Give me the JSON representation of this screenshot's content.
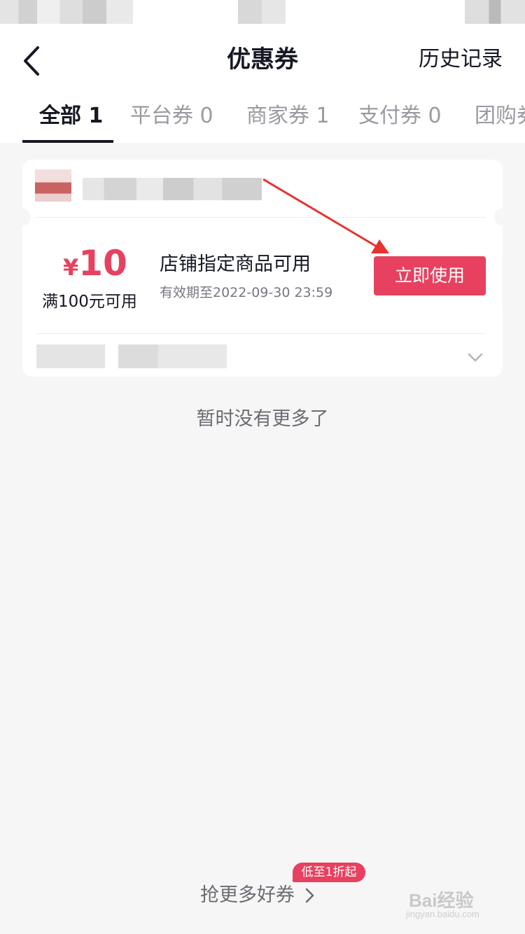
{
  "header": {
    "title": "优惠券",
    "history_label": "历史记录"
  },
  "tabs": [
    {
      "label": "全部 1",
      "active": true
    },
    {
      "label": "平台券 0",
      "active": false
    },
    {
      "label": "商家券 1",
      "active": false
    },
    {
      "label": "支付券 0",
      "active": false
    },
    {
      "label": "团购券",
      "active": false
    }
  ],
  "coupon": {
    "currency": "¥",
    "amount": "10",
    "threshold": "满100元可用",
    "title": "店铺指定商品可用",
    "expiry": "有效期至2022-09-30 23:59",
    "use_button": "立即使用"
  },
  "list_end_text": "暂时没有更多了",
  "footer": {
    "grab_more": "抢更多好券",
    "badge": "低至1折起"
  },
  "watermark": {
    "text": "Bai经验",
    "sub": "jingyan.baidu.com"
  },
  "colors": {
    "accent": "#e7415f",
    "text_primary": "#161823",
    "background": "#f6f6f6"
  }
}
